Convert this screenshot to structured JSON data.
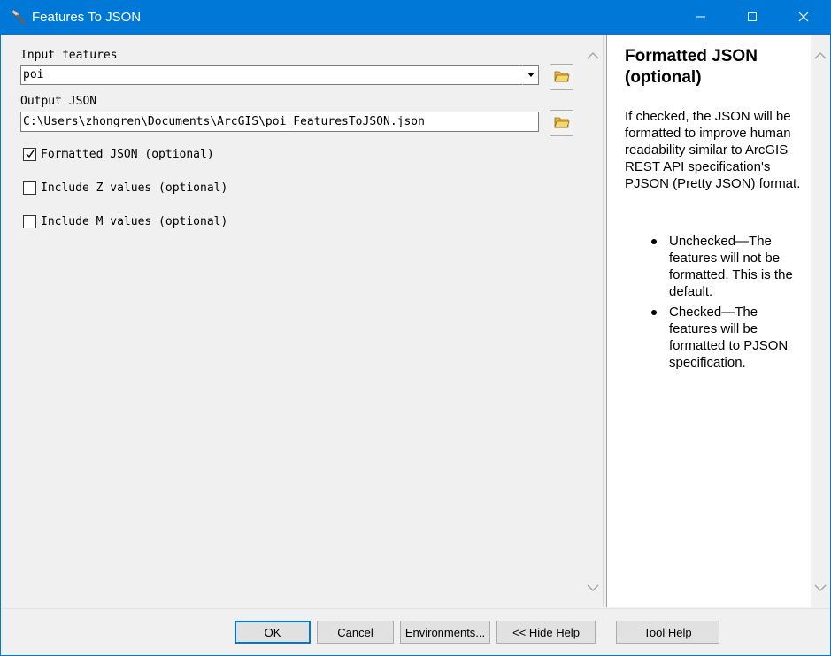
{
  "window": {
    "title": "Features To JSON",
    "icon": "hammer-icon",
    "controls": [
      "minimize-icon",
      "maximize-icon",
      "close-icon"
    ]
  },
  "form": {
    "input_features": {
      "label": "Input features",
      "value": "poi"
    },
    "output_json": {
      "label": "Output JSON",
      "value": "C:\\Users\\zhongren\\Documents\\ArcGIS\\poi_FeaturesToJSON.json"
    },
    "options": [
      {
        "label": "Formatted JSON (optional)",
        "checked": true
      },
      {
        "label": "Include Z values (optional)",
        "checked": false
      },
      {
        "label": "Include M values (optional)",
        "checked": false
      }
    ]
  },
  "help": {
    "title": "Formatted JSON (optional)",
    "body": "If checked, the JSON will be formatted to improve human readability similar to ArcGIS REST API specification's PJSON (Pretty JSON) format.",
    "items": [
      "Unchecked—The features will not be formatted. This is the default.",
      "Checked—The features will be formatted to PJSON specification."
    ]
  },
  "buttons": {
    "ok": "OK",
    "cancel": "Cancel",
    "environments": "Environments...",
    "hide_help": "<< Hide Help",
    "tool_help": "Tool Help"
  },
  "colors": {
    "titlebar": "#0078d7",
    "folder": "#e8b83a"
  }
}
